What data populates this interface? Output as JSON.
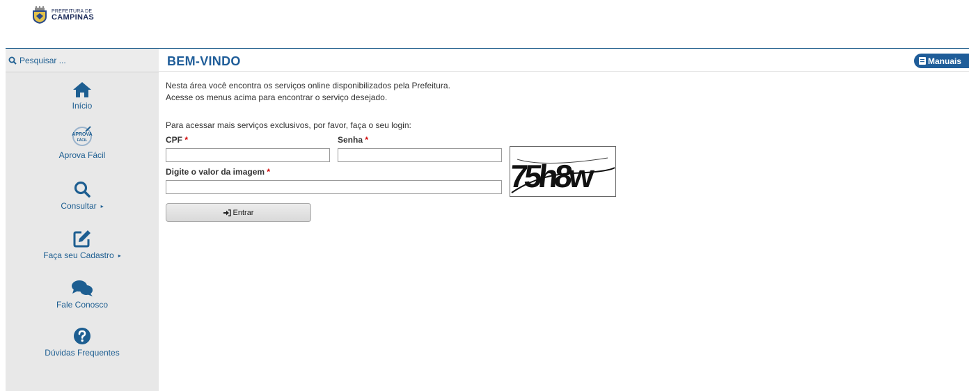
{
  "header": {
    "logo_line1": "PREFEITURA DE",
    "logo_line2": "CAMPINAS"
  },
  "sidebar": {
    "search": {
      "placeholder": "Pesquisar ..."
    },
    "items": [
      {
        "label": "Início",
        "icon": "home-icon"
      },
      {
        "label": "Aprova Fácil",
        "icon": "aprova-facil-icon",
        "icon_text_top": "APROVA",
        "icon_text_bottom": "FÁCIL"
      },
      {
        "label": "Consultar",
        "icon": "search-icon",
        "caret": "▸"
      },
      {
        "label": "Faça seu Cadastro",
        "icon": "edit-icon",
        "caret": "▸"
      },
      {
        "label": "Fale Conosco",
        "icon": "chat-icon"
      },
      {
        "label": "Dúvidas Frequentes",
        "icon": "question-icon"
      }
    ]
  },
  "main": {
    "title": "BEM-VINDO",
    "manuals_label": "Manuais",
    "intro_line1": "Nesta área você encontra os serviços online disponibilizados pela Prefeitura.",
    "intro_line2": "Acesse os menus acima para encontrar o serviço desejado.",
    "login_intro": "Para acessar mais serviços exclusivos, por favor, faça o seu login:",
    "form": {
      "cpf_label": "CPF",
      "password_label": "Senha",
      "captcha_label": "Digite o valor da imagem",
      "required_mark": "*",
      "cpf_value": "",
      "password_value": "",
      "captcha_value": "",
      "captcha_text": "75h8w",
      "submit_label": "Entrar"
    }
  },
  "colors": {
    "brand_blue": "#1f5d99",
    "link_blue": "#1d5e91",
    "sidebar_bg": "#e8e8e8",
    "required_red": "#d00000"
  }
}
